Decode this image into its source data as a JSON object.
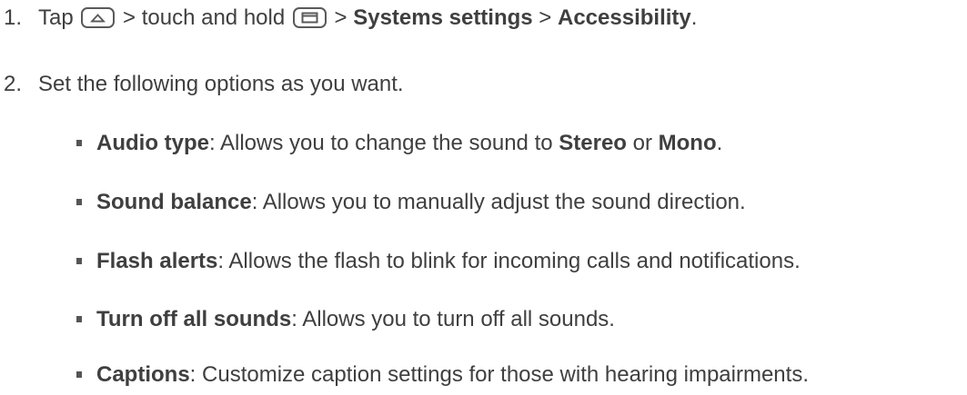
{
  "steps": [
    {
      "number": "1.",
      "text_tap": "Tap",
      "home_key_icon": "home-key-icon",
      "sep1": " > touch and hold ",
      "recent_key_icon": "recent-apps-key-icon",
      "sep2": " > ",
      "systems_settings": "Systems settings",
      "sep3": " > ",
      "accessibility": "Accessibility",
      "end": "."
    },
    {
      "number": "2.",
      "text": "Set the following options as you want."
    }
  ],
  "options": [
    {
      "term": "Audio type",
      "desc_a": ": Allows you to change the sound to ",
      "stereo": "Stereo",
      "or": " or ",
      "mono": "Mono",
      "end": "."
    },
    {
      "term": "Sound balance",
      "desc": ": Allows you to manually adjust the sound direction."
    },
    {
      "term": "Flash alerts",
      "desc": ": Allows the flash to blink for incoming calls and notifications."
    },
    {
      "term": "Turn off all sounds",
      "desc": ": Allows you to turn off all sounds."
    },
    {
      "term": "Captions",
      "desc": ": Customize caption settings for those with hearing impairments."
    }
  ]
}
